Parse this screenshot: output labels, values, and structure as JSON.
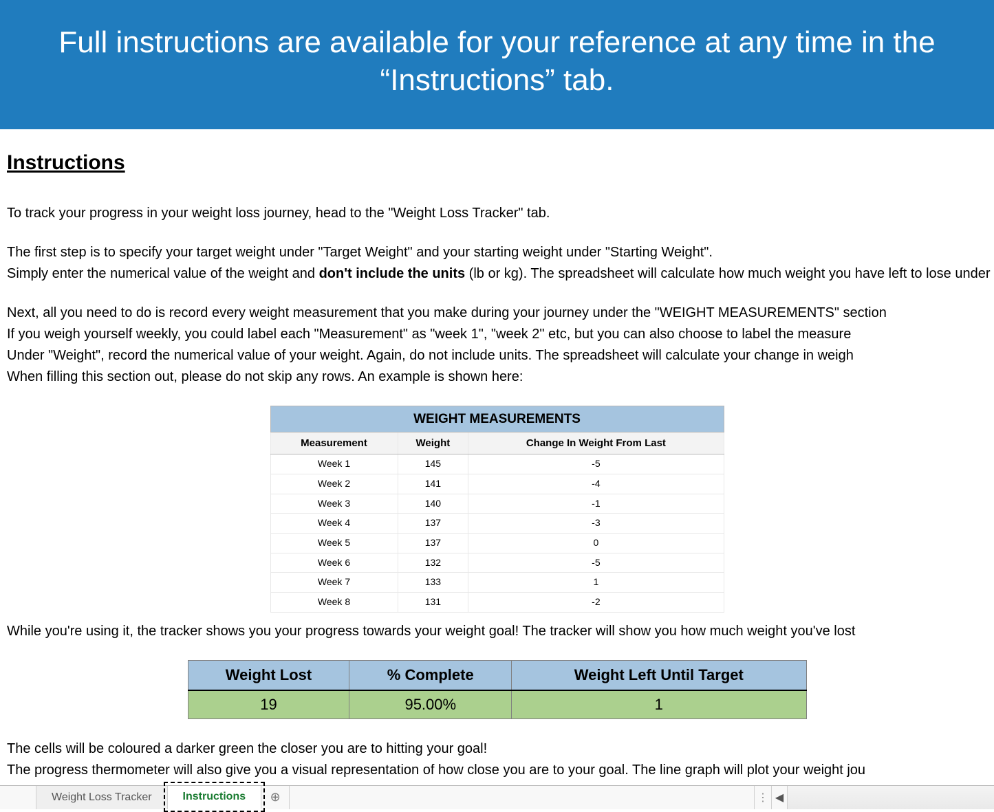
{
  "banner": "Full instructions are available for your reference at any time in the “Instructions” tab.",
  "heading": "Instructions",
  "para1": "To track your progress in your weight loss journey, head to the \"Weight Loss Tracker\" tab.",
  "para2a": "The first step is to specify your target weight under \"Target Weight\" and your starting weight under \"Starting Weight\".",
  "para2b_pre": "Simply enter the numerical value of the weight and ",
  "para2b_bold": "don't include the units",
  "para2b_post": " (lb or kg). The spreadsheet will calculate how much weight you have left to lose under \"Weight To Lose\".",
  "para3a": "Next, all you need to do is record every weight measurement that you make during your journey under the \"WEIGHT MEASUREMENTS\" section",
  "para3b": "If you weigh yourself weekly, you could label each \"Measurement\" as \"week 1\", \"week 2\" etc, but you can also choose to label the measure",
  "para3c": " Under \"Weight\", record the numerical value of your weight. Again, do not include units. The spreadsheet will calculate your change in weigh",
  "para3d": "When filling this section out, please do not skip any rows. An example is shown here:",
  "wm": {
    "title": "WEIGHT MEASUREMENTS",
    "cols": [
      "Measurement",
      "Weight",
      "Change In Weight From Last"
    ],
    "rows": [
      [
        "Week 1",
        "145",
        "-5"
      ],
      [
        "Week 2",
        "141",
        "-4"
      ],
      [
        "Week 3",
        "140",
        "-1"
      ],
      [
        "Week 4",
        "137",
        "-3"
      ],
      [
        "Week 5",
        "137",
        "0"
      ],
      [
        "Week 6",
        "132",
        "-5"
      ],
      [
        "Week 7",
        "133",
        "1"
      ],
      [
        "Week 8",
        "131",
        "-2"
      ]
    ]
  },
  "para4": "While you're using it, the tracker shows you your progress towards your weight goal! The tracker will show you how much weight you've lost ",
  "progress": {
    "cols": [
      "Weight Lost",
      "% Complete",
      "Weight Left Until Target"
    ],
    "row": [
      "19",
      "95.00%",
      "1"
    ]
  },
  "para5": "The cells will be coloured a darker green the closer you are to hitting your goal!",
  "para6": "The progress thermometer will also give you a visual representation of how close you are to your goal. The line graph will plot your weight jou",
  "tabs": {
    "inactive": "Weight Loss Tracker",
    "active": "Instructions",
    "new": "⊕"
  }
}
